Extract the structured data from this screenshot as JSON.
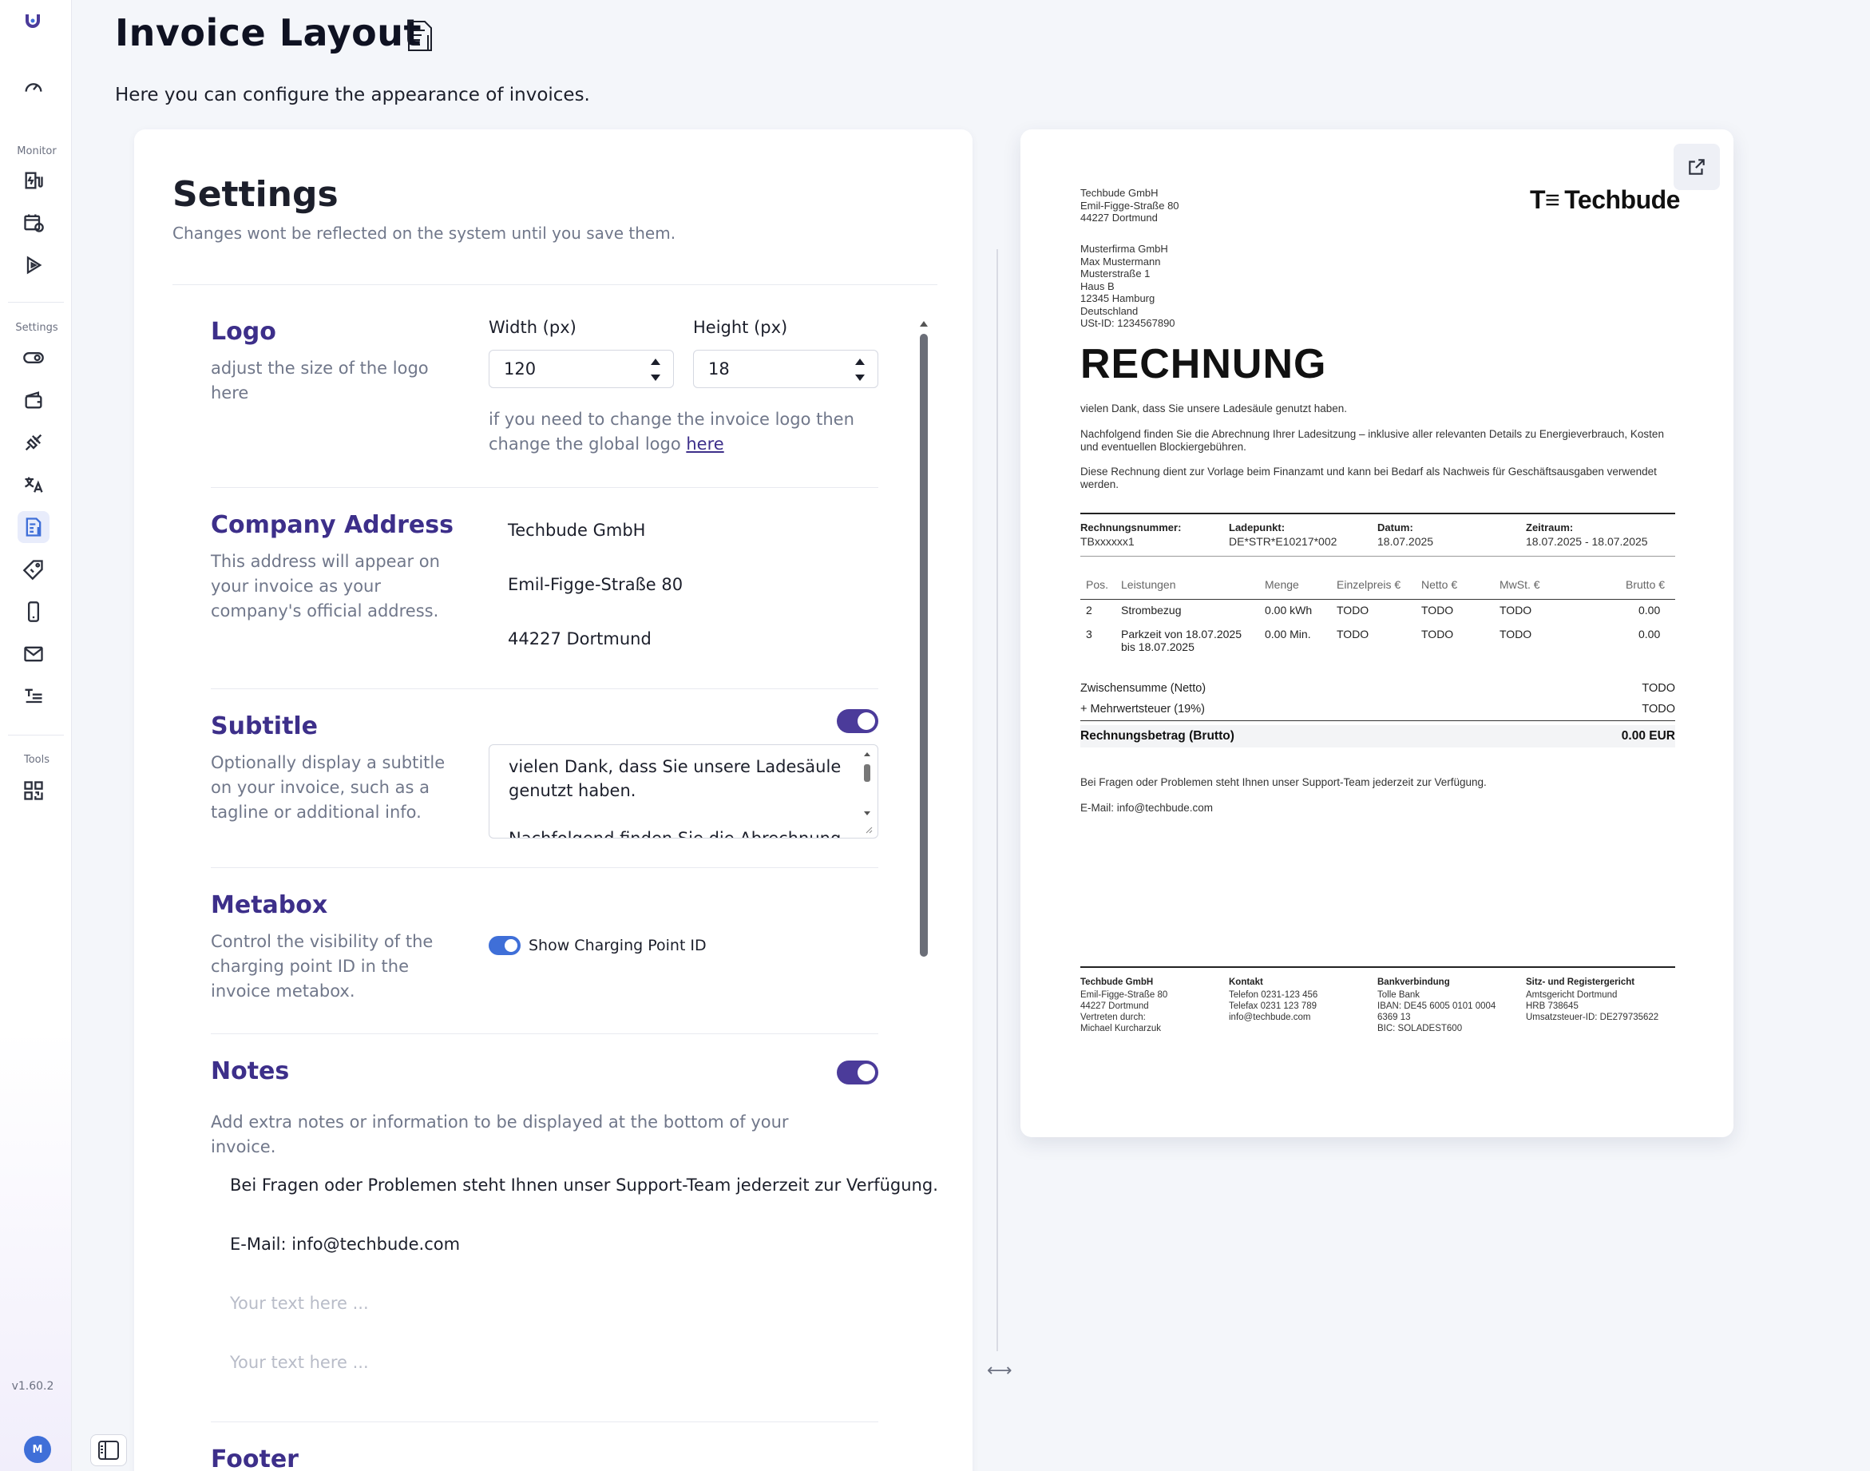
{
  "sidebar": {
    "version": "v1.60.2",
    "avatar_initial": "M",
    "section_monitor": "Monitor",
    "section_settings": "Settings",
    "section_tools": "Tools",
    "items": [
      {
        "name": "dashboard-icon"
      },
      {
        "name": "charging-station-icon"
      },
      {
        "name": "calendar-icon"
      },
      {
        "name": "play-icon"
      },
      {
        "name": "toggle-icon"
      },
      {
        "name": "wallet-icon"
      },
      {
        "name": "plug-icon"
      },
      {
        "name": "translate-icon"
      },
      {
        "name": "invoice-icon",
        "active": true
      },
      {
        "name": "tag-icon"
      },
      {
        "name": "mobile-icon"
      },
      {
        "name": "mail-icon"
      },
      {
        "name": "text-list-icon"
      },
      {
        "name": "qr-code-icon"
      }
    ]
  },
  "header": {
    "title": "Invoice Layout",
    "description": "Here you can configure the appearance of invoices."
  },
  "settings": {
    "title": "Settings",
    "subtitle": "Changes wont be reflected on the system until you save them.",
    "logo": {
      "title": "Logo",
      "description": "adjust the size of the logo here",
      "width_label": "Width (px)",
      "width_value": "120",
      "height_label": "Height (px)",
      "height_value": "18",
      "note": "if you need to change the invoice logo then change the global logo",
      "note_link": "here"
    },
    "company_address": {
      "title": "Company Address",
      "description": "This address will appear on your invoice as your company's official address.",
      "lines": [
        "Techbude GmbH",
        "Emil-Figge-Straße 80",
        "44227 Dortmund"
      ]
    },
    "subtitle_section": {
      "title": "Subtitle",
      "description": "Optionally display a subtitle on your invoice, such as a tagline or additional info.",
      "enabled": true,
      "text_line1": "vielen Dank, dass Sie unsere Ladesäule genutzt haben.",
      "text_line2": "Nachfolgend finden Sie die Abrechnung"
    },
    "metabox": {
      "title": "Metabox",
      "description": "Control the visibility of the charging point ID in the invoice metabox.",
      "toggle_label": "Show Charging Point ID",
      "enabled": true
    },
    "notes": {
      "title": "Notes",
      "description": "Add extra notes or information to be displayed at the bottom of your invoice.",
      "enabled": true,
      "line1": "Bei Fragen oder Problemen steht Ihnen unser Support-Team jederzeit zur Verfügung.",
      "line2": "E-Mail: info@techbude.com",
      "placeholder": "Your text here ..."
    },
    "footer": {
      "title": "Footer"
    }
  },
  "preview": {
    "sender": [
      "Techbude GmbH",
      "Emil-Figge-Straße 80",
      "44227 Dortmund"
    ],
    "logo_mark": "T≡",
    "logo_text": "Techbude",
    "recipient": [
      "Musterfirma GmbH",
      "Max Mustermann",
      "Musterstraße 1",
      "Haus B",
      "12345 Hamburg",
      "Deutschland",
      "USt-ID: 1234567890"
    ],
    "heading": "RECHNUNG",
    "subtitle": "vielen Dank, dass Sie unsere Ladesäule genutzt haben.",
    "paragraph1": "Nachfolgend finden Sie die Abrechnung Ihrer Ladesitzung – inklusive aller relevanten Details zu Energieverbrauch, Kosten und eventuellen Blockiergebühren.",
    "paragraph2": "Diese Rechnung dient zur Vorlage beim Finanzamt und kann bei Bedarf als Nachweis für Geschäftsausgaben verwendet werden.",
    "meta": [
      {
        "label": "Rechnungsnummer:",
        "value": "TBxxxxxx1"
      },
      {
        "label": "Ladepunkt:",
        "value": "DE*STR*E10217*002"
      },
      {
        "label": "Datum:",
        "value": "18.07.2025"
      },
      {
        "label": "Zeitraum:",
        "value": "18.07.2025 - 18.07.2025"
      }
    ],
    "table_headers": [
      "Pos.",
      "Leistungen",
      "Menge",
      "Einzelpreis €",
      "Netto €",
      "MwSt. €",
      "Brutto €"
    ],
    "rows": [
      {
        "pos": "2",
        "service": "Strombezug",
        "service2": "",
        "qty": "0.00 kWh",
        "unit": "TODO",
        "net": "TODO",
        "vat": "TODO",
        "gross": "0.00"
      },
      {
        "pos": "3",
        "service": "Parkzeit von 18.07.2025",
        "service2": "bis 18.07.2025",
        "qty": "0.00 Min.",
        "unit": "TODO",
        "net": "TODO",
        "vat": "TODO",
        "gross": "0.00"
      }
    ],
    "subtotal_label": "Zwischensumme (Netto)",
    "subtotal_value": "TODO",
    "vat_label": "+ Mehrwertsteuer (19%)",
    "vat_value": "TODO",
    "total_label": "Rechnungsbetrag (Brutto)",
    "total_value": "0.00 EUR",
    "note1": "Bei Fragen oder Problemen steht Ihnen unser Support-Team jederzeit zur Verfügung.",
    "note2": "E-Mail: info@techbude.com",
    "footer_cols": [
      {
        "title": "Techbude GmbH",
        "lines": [
          "Emil-Figge-Straße 80",
          "44227 Dortmund",
          "Vertreten durch:",
          "Michael Kurcharzuk"
        ]
      },
      {
        "title": "Kontakt",
        "lines": [
          "Telefon 0231-123 456",
          "Telefax 0231 123 789",
          "info@techbude.com"
        ]
      },
      {
        "title": "Bankverbindung",
        "lines": [
          "Tolle Bank",
          "IBAN: DE45 6005 0101 0004",
          "6369 13",
          "BIC: SOLADEST600"
        ]
      },
      {
        "title": "Sitz- und Registergericht",
        "lines": [
          "Amtsgericht Dortmund",
          "HRB 738645",
          "Umsatzsteuer-ID: DE279735622"
        ]
      }
    ]
  },
  "colors": {
    "accent": "#3d2f8a",
    "toggle": "#4b3b9a",
    "link_blue": "#3f6fd8"
  }
}
